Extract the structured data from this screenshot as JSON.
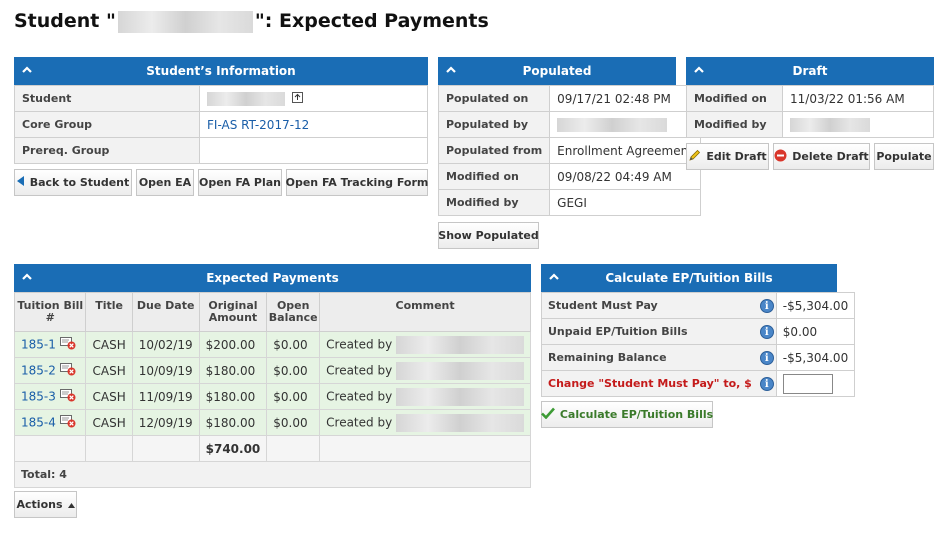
{
  "page": {
    "title_prefix": "Student \"",
    "title_suffix": "\": Expected Payments"
  },
  "student_info": {
    "header": "Student’s Information",
    "rows": [
      {
        "label": "Student",
        "value": ""
      },
      {
        "label": "Core Group",
        "value": "FI-AS RT-2017-12"
      },
      {
        "label": "Prereq. Group",
        "value": ""
      }
    ]
  },
  "nav_buttons": {
    "back": "Back to Student",
    "open_ea": "Open EA",
    "open_fa_plan": "Open FA Plan",
    "open_fa_tracking": "Open FA Tracking Form"
  },
  "populated": {
    "header": "Populated",
    "rows": [
      {
        "label": "Populated on",
        "value": "09/17/21 02:48 PM"
      },
      {
        "label": "Populated by",
        "value": ""
      },
      {
        "label": "Populated from",
        "value": "Enrollment Agreement"
      },
      {
        "label": "Modified on",
        "value": "09/08/22 04:49 AM"
      },
      {
        "label": "Modified by",
        "value": "GEGI"
      }
    ],
    "show_button": "Show Populated"
  },
  "draft": {
    "header": "Draft",
    "rows": [
      {
        "label": "Modified on",
        "value": "11/03/22 01:56 AM"
      },
      {
        "label": "Modified by",
        "value": ""
      }
    ],
    "edit_button": "Edit Draft",
    "delete_button": "Delete Draft",
    "populate_button": "Populate"
  },
  "expected_payments": {
    "header": "Expected Payments",
    "columns": [
      "Tuition Bill #",
      "Title",
      "Due Date",
      "Original Amount",
      "Open Balance",
      "Comment"
    ],
    "rows": [
      {
        "bill": "185-1",
        "title": "CASH",
        "due": "10/02/19",
        "original": "$200.00",
        "open": "$0.00",
        "comment": "Created by"
      },
      {
        "bill": "185-2",
        "title": "CASH",
        "due": "10/09/19",
        "original": "$180.00",
        "open": "$0.00",
        "comment": "Created by"
      },
      {
        "bill": "185-3",
        "title": "CASH",
        "due": "11/09/19",
        "original": "$180.00",
        "open": "$0.00",
        "comment": "Created by"
      },
      {
        "bill": "185-4",
        "title": "CASH",
        "due": "12/09/19",
        "original": "$180.00",
        "open": "$0.00",
        "comment": "Created by"
      }
    ],
    "sum_original": "$740.00",
    "total_label": "Total: 4",
    "actions_button": "Actions"
  },
  "calculate": {
    "header": "Calculate EP/Tuition Bills",
    "rows": [
      {
        "label": "Student Must Pay",
        "value": "-$5,304.00"
      },
      {
        "label": "Unpaid EP/Tuition Bills",
        "value": "$0.00"
      },
      {
        "label": "Remaining Balance",
        "value": "-$5,304.00"
      }
    ],
    "change_label": "Change \"Student Must Pay\" to, $",
    "change_value": "",
    "calc_button": "Calculate EP/Tuition Bills"
  },
  "colors": {
    "header_blue": "#1a6db5",
    "row_green": "#e6f4e3",
    "link_blue": "#1a5ea8",
    "alert_red": "#c41a1a"
  }
}
